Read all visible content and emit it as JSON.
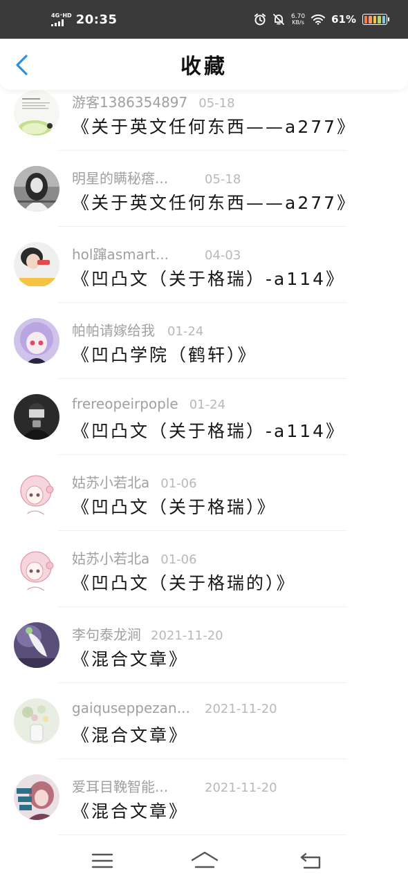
{
  "status_bar": {
    "network": "4G⁺HD",
    "time": "20:35",
    "speed_value": "6.70",
    "speed_unit": "KB/s",
    "battery": "61%",
    "icons": [
      "signal-icon",
      "alarm-icon",
      "mute-icon",
      "wifi-icon",
      "battery-icon"
    ]
  },
  "header": {
    "title": "收藏",
    "back_icon": "chevron-left-icon",
    "accent_color": "#2e8fdc"
  },
  "favorites": [
    {
      "author": "游客1386354897",
      "date": "05-18",
      "title": "《关于英文任何东西——a277》",
      "avatar": "avatar-text-image"
    },
    {
      "author": "明星的瞒秘瘩...",
      "date": "05-18",
      "title": "《关于英文任何东西——a277》",
      "avatar": "avatar-girl-bw"
    },
    {
      "author": "hol蹿asmart...",
      "date": "04-03",
      "title": "《凹凸文（关于格瑞）-a114》",
      "avatar": "avatar-girl-phone"
    },
    {
      "author": "帕帕请嫁给我",
      "date": "01-24",
      "title": "《凹凸学院（鹤轩）》",
      "avatar": "avatar-anime-purple"
    },
    {
      "author": "frereopeirpople",
      "date": "01-24",
      "title": "《凹凸文（关于格瑞）-a114》",
      "avatar": "avatar-dark-figure"
    },
    {
      "author": "姑苏小若北a",
      "date": "01-06",
      "title": "《凹凸文（关于格瑞）》",
      "avatar": "avatar-anime-pink"
    },
    {
      "author": "姑苏小若北a",
      "date": "01-06",
      "title": "《凹凸文（关于格瑞的）》",
      "avatar": "avatar-anime-pink"
    },
    {
      "author": "李句泰龙涧",
      "date": "2021-11-20",
      "title": "《混合文章》",
      "avatar": "avatar-flower-purple"
    },
    {
      "author": "gaiquseppezan...",
      "date": "2021-11-20",
      "title": "《混合文章》",
      "avatar": "avatar-flowers-vase"
    },
    {
      "author": "爱耳目鞔智能...",
      "date": "2021-11-20",
      "title": "《混合文章》",
      "avatar": "avatar-girl-text"
    }
  ],
  "nav_bar": {
    "icons": [
      "menu-icon",
      "home-icon",
      "back-icon"
    ]
  }
}
